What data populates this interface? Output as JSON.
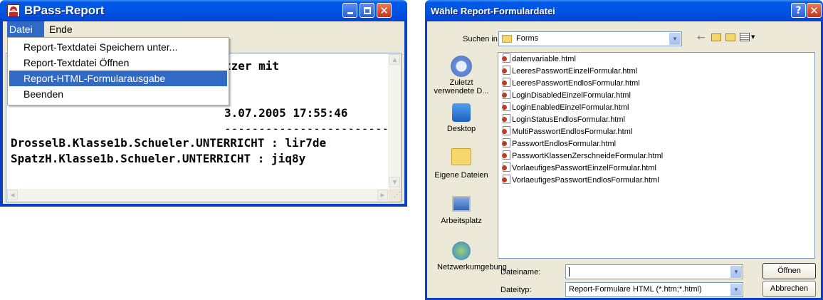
{
  "app_window": {
    "title": "BPass-Report",
    "menu": {
      "file": "Datei",
      "end": "Ende"
    },
    "dropdown": [
      "Report-Textdatei Speichern unter...",
      "Report-Textdatei Öffnen",
      "Report-HTML-Formularausgabe",
      "Beenden"
    ],
    "selected_index": 2,
    "content": {
      "line1_partial": "tzer mit",
      "line2_partial": "3.07.2005 17:55:46",
      "separator": "------------------------",
      "line3": "DrosselB.Klasse1b.Schueler.UNTERRICHT : lir7de",
      "line4": "SpatzH.Klasse1b.Schueler.UNTERRICHT : jiq8y"
    }
  },
  "dialog": {
    "title": "Wähle Report-Formulardatei",
    "help_label": "?",
    "lookin_label": "Suchen in:",
    "lookin_value": "Forms",
    "places": [
      {
        "label": "Zuletzt verwendete D...",
        "icon": "recent-icon"
      },
      {
        "label": "Desktop",
        "icon": "desktop-icon"
      },
      {
        "label": "Eigene Dateien",
        "icon": "my-documents-icon"
      },
      {
        "label": "Arbeitsplatz",
        "icon": "my-computer-icon"
      },
      {
        "label": "Netzwerkumgebung",
        "icon": "network-icon"
      }
    ],
    "files": [
      "datenvariable.html",
      "LeeresPasswortEinzelFormular.html",
      "LeeresPasswortEndlosFormular.html",
      "LoginDisabledEinzelFormular.html",
      "LoginEnabledEinzelFormular.html",
      "LoginStatusEndlosFormular.html",
      "MultiPasswortEndlosFormular.html",
      "PasswortEndlosFormular.html",
      "PasswortKlassenZerschneideFormular.html",
      "VorlaeufigesPasswortEinzelFormular.html",
      "VorlaeufigesPasswortEndlosFormular.html"
    ],
    "filename_label": "Dateiname:",
    "filename_value": "",
    "filetype_label": "Dateityp:",
    "filetype_value": "Report-Formulare HTML (*.htm;*.html)",
    "open_button": "Öffnen",
    "cancel_button": "Abbrechen"
  }
}
